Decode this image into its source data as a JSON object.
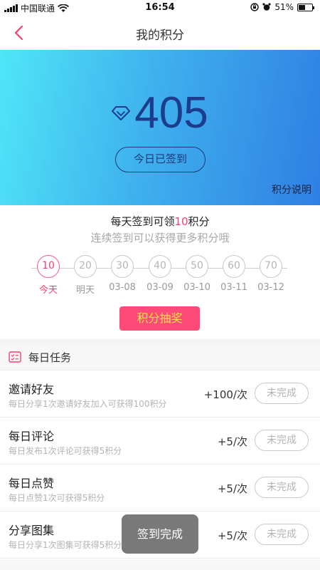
{
  "status_bar": {
    "carrier": "中国联通",
    "time": "16:54",
    "battery": "51%"
  },
  "nav": {
    "title": "我的积分"
  },
  "hero": {
    "points": "405",
    "signed_label": "今日已签到",
    "rules_link": "积分说明"
  },
  "signin": {
    "title_prefix": "每天签到可领",
    "title_points": "10",
    "title_suffix": "积分",
    "subtitle": "连续签到可以获得更多积分哦",
    "days": [
      {
        "points": "10",
        "date": "今天"
      },
      {
        "points": "20",
        "date": "明天"
      },
      {
        "points": "30",
        "date": "03-08"
      },
      {
        "points": "40",
        "date": "03-09"
      },
      {
        "points": "50",
        "date": "03-10"
      },
      {
        "points": "60",
        "date": "03-11"
      },
      {
        "points": "70",
        "date": "03-12"
      }
    ],
    "lottery_label": "积分抽奖"
  },
  "tasks": {
    "header": "每日任务",
    "items": [
      {
        "name": "邀请好友",
        "desc": "每日分享1次邀请好友加入可获得100积分",
        "reward": "+100/次",
        "status": "未完成"
      },
      {
        "name": "每日评论",
        "desc": "每日发布1次评论可获得5积分",
        "reward": "+5/次",
        "status": "未完成"
      },
      {
        "name": "每日点赞",
        "desc": "每日点赞1次可获得5积分",
        "reward": "+5/次",
        "status": "未完成"
      },
      {
        "name": "分享图集",
        "desc": "每日分享1次图集可获得5积分",
        "reward": "+5/次",
        "status": "未完成"
      }
    ]
  },
  "toast": "签到完成",
  "colors": {
    "accent": "#ff3c6e",
    "lottery_bg": "#ff4a79",
    "lottery_text": "#ffe04a",
    "points_text": "#1c3d8c"
  }
}
